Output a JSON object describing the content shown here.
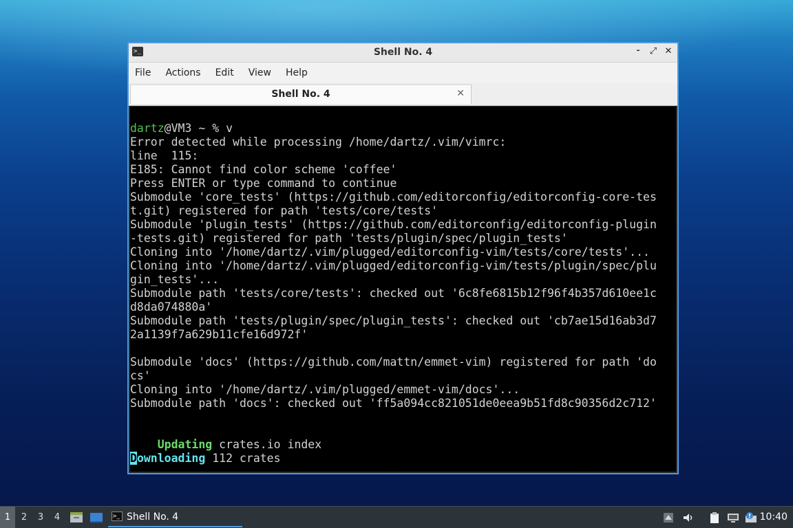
{
  "window": {
    "title": "Shell No. 4",
    "title_icon": "terminal-icon",
    "controls": {
      "minimize": "⁃",
      "maximize": "⤢",
      "close": "✕"
    }
  },
  "menu": [
    "File",
    "Actions",
    "Edit",
    "View",
    "Help"
  ],
  "tab": {
    "label": "Shell No. 4",
    "close": "✕"
  },
  "terminal": {
    "prompt_user": "dartz",
    "prompt_rest": "@VM3 ~ % v",
    "lines": [
      "Error detected while processing /home/dartz/.vim/vimrc:",
      "line  115:",
      "E185: Cannot find color scheme 'coffee'",
      "Press ENTER or type command to continue",
      "Submodule 'core_tests' (https://github.com/editorconfig/editorconfig-core-tes",
      "t.git) registered for path 'tests/core/tests'",
      "Submodule 'plugin_tests' (https://github.com/editorconfig/editorconfig-plugin",
      "-tests.git) registered for path 'tests/plugin/spec/plugin_tests'",
      "Cloning into '/home/dartz/.vim/plugged/editorconfig-vim/tests/core/tests'...",
      "Cloning into '/home/dartz/.vim/plugged/editorconfig-vim/tests/plugin/spec/plu",
      "gin_tests'...",
      "Submodule path 'tests/core/tests': checked out '6c8fe6815b12f96f4b357d610ee1c",
      "d8da074880a'",
      "Submodule path 'tests/plugin/spec/plugin_tests': checked out 'cb7ae15d16ab3d7",
      "2a1139f7a629b11cfe16d972f'",
      "",
      "Submodule 'docs' (https://github.com/mattn/emmet-vim) registered for path 'do",
      "cs'",
      "Cloning into '/home/dartz/.vim/plugged/emmet-vim/docs'...",
      "Submodule path 'docs': checked out 'ff5a094cc821051de0eea9b51fd8c90356d2c712'",
      "",
      ""
    ],
    "updating_label": "Updating",
    "updating_text": " crates.io index",
    "downloading_label": "Downloading",
    "downloading_text": " 112 crates"
  },
  "taskbar": {
    "workspaces": [
      "1",
      "2",
      "3",
      "4"
    ],
    "active_workspace": "1",
    "task_label": "Shell No. 4",
    "clock": "10:40",
    "tray_icons": [
      "up-arrow-icon",
      "volume-icon",
      "clipboard-icon",
      "network-icon",
      "update-notifier-icon"
    ]
  }
}
